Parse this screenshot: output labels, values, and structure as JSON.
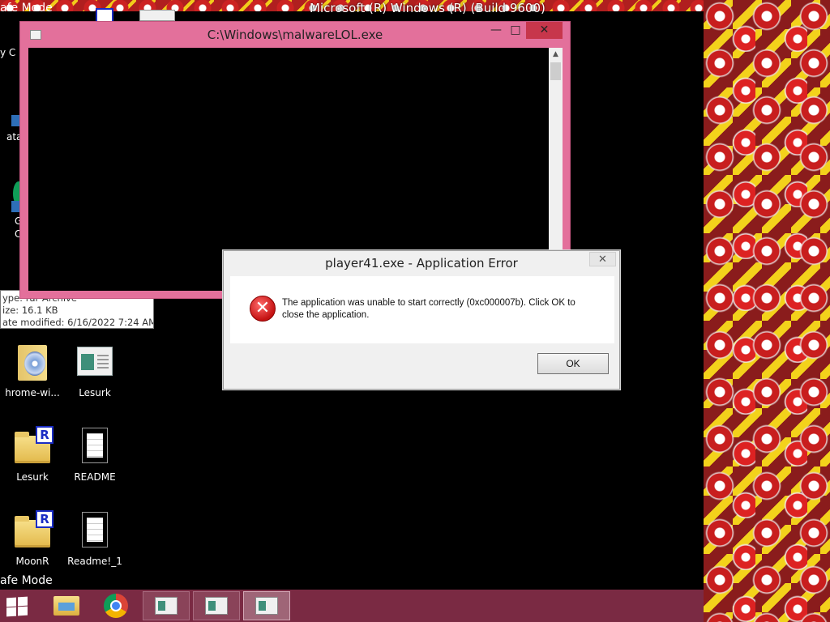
{
  "desktop": {
    "os_title": "Microsoft (R) Windows (R) (Build 9600)",
    "safe_mode_top": "afe Mode",
    "safe_mode_bottom": "afe Mode",
    "left_edge_text": [
      "y C",
      "ata",
      "G",
      "C"
    ]
  },
  "tooltip": {
    "type": "ype: rar Archive",
    "size": "ize: 16.1 KB",
    "modified": "ate modified: 6/16/2022 7:24 AM"
  },
  "icons": [
    {
      "label": "hrome-wi...",
      "icon": "dvd-folder-icon"
    },
    {
      "label": "Lesurk",
      "icon": "app-window-icon"
    },
    {
      "label": "Lesurk",
      "icon": "winrar-folder-icon"
    },
    {
      "label": "README",
      "icon": "text-document-icon"
    },
    {
      "label": "MoonR",
      "icon": "winrar-folder-icon"
    },
    {
      "label": "Readme!_1",
      "icon": "text-document-icon"
    }
  ],
  "main_window": {
    "title": "C:\\Windows\\malwareLOL.exe",
    "minimize": "—",
    "maximize": "□",
    "close": "✕"
  },
  "error_dialog": {
    "title": "player41.exe - Application Error",
    "message": "The application was unable to start correctly (0xc000007b). Click OK to close the application.",
    "ok_label": "OK",
    "close": "✕",
    "icon_glyph": "✕"
  },
  "taskbar": {
    "items": [
      "start-icon",
      "file-explorer-icon",
      "chrome-icon",
      "window-icon",
      "window-icon",
      "window-icon"
    ]
  },
  "colors": {
    "window_frame": "#e3709b",
    "taskbar": "#7a2a43",
    "close_red": "#c7364b"
  }
}
